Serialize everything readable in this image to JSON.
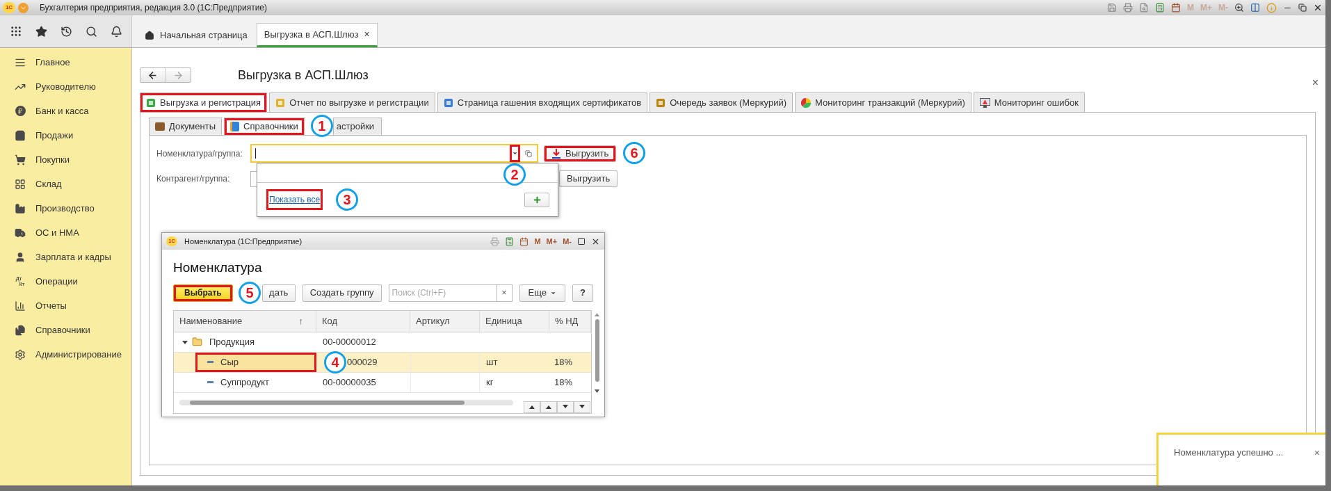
{
  "window": {
    "logo": "1С",
    "title": "Бухгалтерия предприятия, редакция 3.0  (1С:Предприятие)",
    "memory_buttons": [
      "M",
      "M+",
      "M-"
    ]
  },
  "open_tabs": [
    {
      "label": "Начальная страница",
      "selected": false
    },
    {
      "label": "Выгрузка в АСП.Шлюз",
      "selected": true,
      "close": "×"
    }
  ],
  "sidebar": {
    "items": [
      {
        "label": "Главное"
      },
      {
        "label": "Руководителю"
      },
      {
        "label": "Банк и касса"
      },
      {
        "label": "Продажи"
      },
      {
        "label": "Покупки"
      },
      {
        "label": "Склад"
      },
      {
        "label": "Производство"
      },
      {
        "label": "ОС и НМА"
      },
      {
        "label": "Зарплата и кадры"
      },
      {
        "label": "Операции",
        "icon_text": [
          "Дт",
          "Кт"
        ]
      },
      {
        "label": "Отчеты"
      },
      {
        "label": "Справочники"
      },
      {
        "label": "Администрирование"
      }
    ]
  },
  "page": {
    "title": "Выгрузка в АСП.Шлюз",
    "close": "×"
  },
  "tabs": [
    {
      "label": "Выгрузка и регистрация",
      "selected": true,
      "highlighted": true
    },
    {
      "label": "Отчет по выгрузке и регистрации",
      "selected": false,
      "highlighted": false
    },
    {
      "label": "Страница гашения входящих сертификатов",
      "selected": false,
      "highlighted": false
    },
    {
      "label": "Очередь заявок (Меркурий)",
      "selected": false,
      "highlighted": false
    },
    {
      "label": "Мониторинг транзакций (Меркурий)",
      "selected": false,
      "highlighted": false
    },
    {
      "label": "Мониторинг ошибок",
      "selected": false,
      "highlighted": false
    }
  ],
  "subtabs": [
    {
      "label": "Документы",
      "selected": false,
      "highlighted": false
    },
    {
      "label": "Справочники",
      "selected": true,
      "highlighted": true,
      "callout": "1"
    },
    {
      "label": "астройки",
      "selected": false,
      "highlighted": false
    }
  ],
  "form": {
    "rows": [
      {
        "label": "Номенклатура/группа:",
        "focused": true,
        "button": "Выгрузить",
        "button_highlighted": true,
        "callout": "6"
      },
      {
        "label": "Контрагент/группа:",
        "focused": false,
        "button": "Выгрузить",
        "button_highlighted": false
      }
    ]
  },
  "dropdown": {
    "button_highlighted": true,
    "callout": "2",
    "link": "Показать все",
    "link_highlighted": true,
    "link_callout": "3"
  },
  "popup": {
    "logo": "1С",
    "title": "Номенклатура  (1С:Предприятие)",
    "memory_buttons": [
      "M",
      "M+",
      "M-"
    ],
    "heading": "Номенклатура",
    "toolbar": {
      "select_button": "Выбрать",
      "select_highlighted": true,
      "select_callout": "5",
      "create_button": "дать",
      "create_group_button": "Создать группу",
      "search_placeholder": "Поиск (Ctrl+F)",
      "search_clear": "×",
      "more_button": "Еще",
      "help_button": "?"
    },
    "table": {
      "columns": [
        {
          "label": "Наименование",
          "sort": "↑"
        },
        {
          "label": "Код"
        },
        {
          "label": "Артикул"
        },
        {
          "label": "Единица"
        },
        {
          "label": "% НД"
        }
      ],
      "rows": [
        {
          "name": "Продукция",
          "code": "00-00000012",
          "expanded": true,
          "selected": false,
          "children": [
            {
              "name": "Сыр",
              "code": "000029",
              "unit": "шт",
              "vat": "18%",
              "selected": true,
              "highlighted": true,
              "callout": "4"
            },
            {
              "name": "Суппродукт",
              "code": "00-00000035",
              "unit": "кг",
              "vat": "18%",
              "selected": false,
              "highlighted": false
            }
          ]
        }
      ]
    }
  },
  "notification": {
    "text": "Номенклатура успешно ...",
    "close": "×"
  }
}
